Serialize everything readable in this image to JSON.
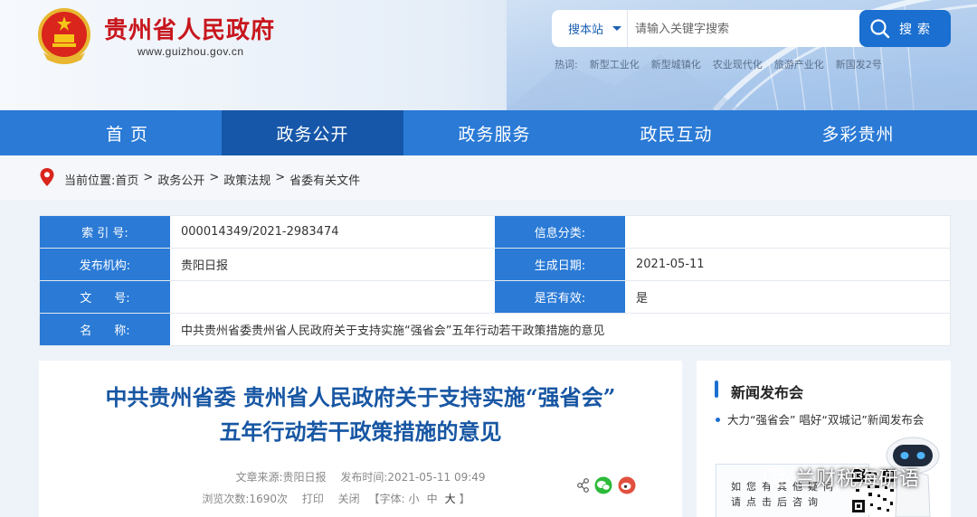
{
  "header": {
    "site_title": "贵州省人民政府",
    "site_url": "www.guizhou.gov.cn",
    "search": {
      "scope": "搜本站",
      "placeholder": "请输入关键字搜索",
      "button_label": "搜索"
    },
    "hotwords_label": "热词:",
    "hotwords": [
      "新型工业化",
      "新型城镇化",
      "农业现代化",
      "旅游产业化",
      "新国发2号"
    ]
  },
  "nav": {
    "items": [
      {
        "label": "首页"
      },
      {
        "label": "政务公开"
      },
      {
        "label": "政务服务"
      },
      {
        "label": "政民互动"
      },
      {
        "label": "多彩贵州"
      }
    ],
    "active_index": 1
  },
  "breadcrumb": {
    "prefix": "当前位置:",
    "items": [
      "首页",
      "政务公开",
      "政策法规",
      "省委有关文件"
    ],
    "separator": ">"
  },
  "meta": {
    "index_label": "索 引 号:",
    "index_value": "000014349/2021-2983474",
    "category_label": "信息分类:",
    "category_value": "",
    "publisher_label": "发布机构:",
    "publisher_value": "贵阳日报",
    "date_label": "生成日期:",
    "date_value": "2021-05-11",
    "docno_label": "文      号:",
    "docno_value": "",
    "valid_label": "是否有效:",
    "valid_value": "是",
    "name_label": "名      称:",
    "name_value": "中共贵州省委贵州省人民政府关于支持实施“强省会”五年行动若干政策措施的意见"
  },
  "article": {
    "title_line1": "中共贵州省委 贵州省人民政府关于支持实施“强省会”",
    "title_line2": "五年行动若干政策措施的意见",
    "source": "文章来源:贵阳日报",
    "published": "发布时间:2021-05-11 09:49",
    "views": "浏览次数:1690次",
    "print": "打印",
    "close": "关闭",
    "font_prefix": "【字体:",
    "font_small": "小",
    "font_medium": "中",
    "font_large": "大",
    "font_suffix": "】"
  },
  "sidebar": {
    "title": "新闻发布会",
    "item": "大力“强省会” 唱好“双城记”新闻发布会",
    "qr_line1": "如您有其他疑问",
    "qr_line2": "请点击后咨询"
  },
  "watermark": "兰财税海研语",
  "colors": {
    "brand_red": "#c8161d",
    "nav_blue": "#2a7ad6",
    "nav_active": "#1657a9",
    "title_blue": "#1756a3"
  }
}
